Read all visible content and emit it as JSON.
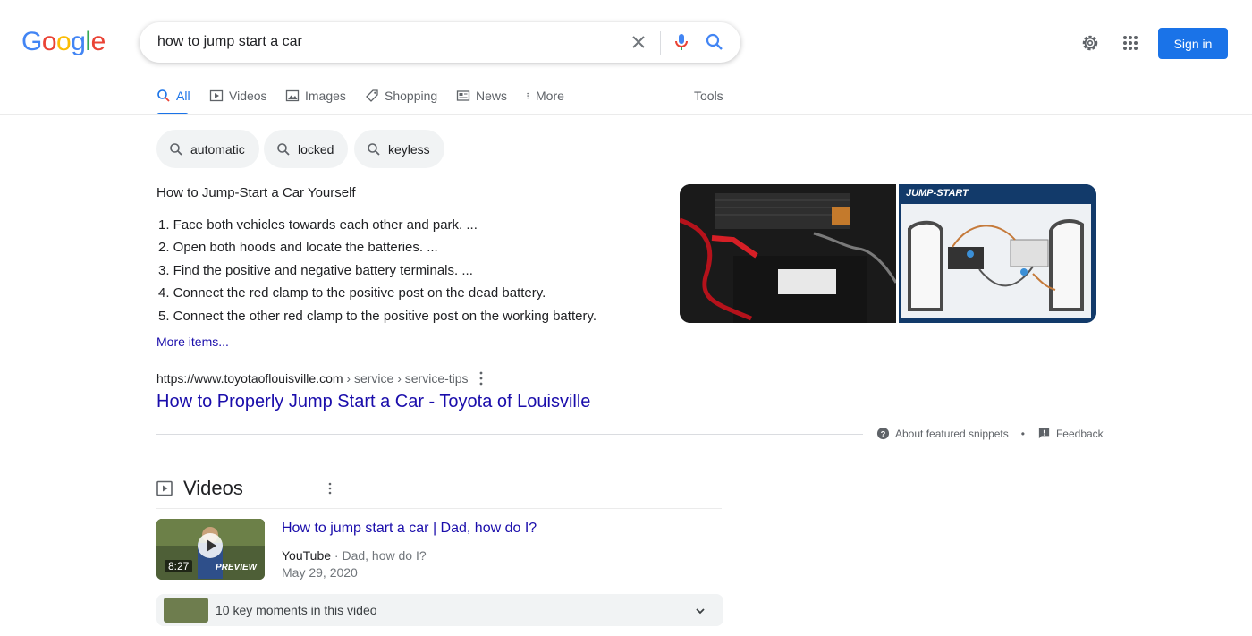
{
  "search": {
    "logo_letters": [
      {
        "ch": "G",
        "color": "#4285f4"
      },
      {
        "ch": "o",
        "color": "#ea4335"
      },
      {
        "ch": "o",
        "color": "#fbbc05"
      },
      {
        "ch": "g",
        "color": "#4285f4"
      },
      {
        "ch": "l",
        "color": "#34a853"
      },
      {
        "ch": "e",
        "color": "#ea4335"
      }
    ],
    "query": "how to jump start a car",
    "icons": [
      "close-icon",
      "mic-icon",
      "search-icon"
    ]
  },
  "header": {
    "signin_label": "Sign in",
    "icons": [
      "gear-icon",
      "apps-grid-icon"
    ],
    "accent": "#1a73e8"
  },
  "tabs": [
    {
      "label": "All",
      "icon": "search-icon",
      "active": true
    },
    {
      "label": "Videos",
      "icon": "play-icon"
    },
    {
      "label": "Images",
      "icon": "image-icon"
    },
    {
      "label": "Shopping",
      "icon": "tag-icon"
    },
    {
      "label": "News",
      "icon": "news-icon"
    },
    {
      "label": "More",
      "icon": "kebab-icon"
    },
    {
      "label": "Tools"
    }
  ],
  "chips": [
    "automatic",
    "locked",
    "keyless"
  ],
  "snippet": {
    "title": "How to Jump-Start a Car Yourself",
    "steps": [
      "1. Face both vehicles towards each other and park. ...",
      "2. Open both hoods and locate the batteries. ...",
      "3. Find the positive and negative battery terminals. ...",
      "4. Connect the red clamp to the positive post on the dead battery.",
      "5. Connect the other red clamp to the positive post on the working battery."
    ],
    "more_items": "More items...",
    "image_caption": "JUMP-START",
    "cite_domain": "https://www.toyotaoflouisville.com",
    "cite_path": " › service › service-tips",
    "result_title": "How to Properly Jump Start a Car - Toyota of Louisville",
    "about_label": "About featured snippets",
    "bullet": "•",
    "feedback_label": "Feedback"
  },
  "videos": {
    "heading": "Videos",
    "items": [
      {
        "title": "How to jump start a car | Dad, how do I?",
        "source": "YouTube",
        "channel": " · Dad, how do I?",
        "date": "May 29, 2020",
        "duration": "8:27",
        "preview_label": "PREVIEW"
      }
    ],
    "key_moments": "10 key moments in this video"
  }
}
